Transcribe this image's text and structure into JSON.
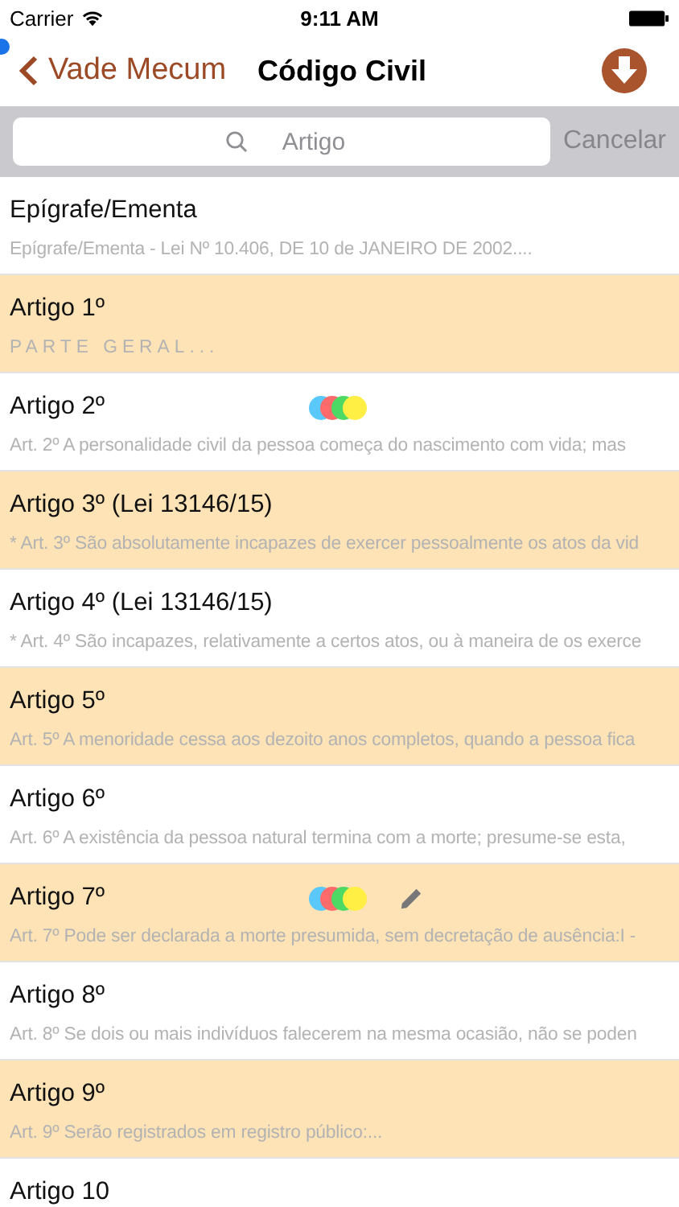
{
  "status_bar": {
    "carrier": "Carrier",
    "time": "9:11 AM"
  },
  "nav": {
    "back": "Vade Mecum",
    "title": "Código Civil"
  },
  "search": {
    "placeholder": "Artigo",
    "cancel": "Cancelar"
  },
  "rows": [
    {
      "title": "Epígrafe/Ementa",
      "summary": "Epígrafe/Ementa - Lei Nº 10.406, DE 10 de JANEIRO DE 2002....",
      "highlighted": false
    },
    {
      "title": "Artigo 1º",
      "summary": "PARTE GERAL...",
      "highlighted": true,
      "letter_spaced": true
    },
    {
      "title": "Artigo 2º",
      "summary": "Art. 2º A personalidade civil da pessoa começa do nascimento com vida; mas",
      "highlighted": false,
      "tags": [
        {
          "color": "#5ac8fa"
        },
        {
          "color": "#ff6b6b"
        },
        {
          "color": "#4cd964"
        },
        {
          "color": "#ffee44"
        }
      ]
    },
    {
      "title": "Artigo 3º (Lei 13146/15)",
      "summary": "* Art. 3º São absolutamente incapazes de exercer pessoalmente os atos da vid",
      "highlighted": true
    },
    {
      "title": "Artigo 4º (Lei 13146/15)",
      "summary": "* Art. 4º São incapazes, relativamente a certos atos, ou à maneira de os exerce",
      "highlighted": false
    },
    {
      "title": "Artigo 5º",
      "summary": "Art. 5º A menoridade cessa aos dezoito anos completos, quando a pessoa fica",
      "highlighted": true
    },
    {
      "title": "Artigo 6º",
      "summary": "Art. 6º A existência da pessoa natural termina com a morte; presume-se esta,",
      "highlighted": false
    },
    {
      "title": "Artigo 7º",
      "summary": "Art. 7º Pode ser declarada a morte presumida, sem decretação de ausência:I -",
      "highlighted": true,
      "annotated": true,
      "tags": [
        {
          "color": "#5ac8fa"
        },
        {
          "color": "#ff6b6b"
        },
        {
          "color": "#4cd964"
        },
        {
          "color": "#ffee44"
        }
      ]
    },
    {
      "title": "Artigo 8º",
      "summary": "Art. 8º Se dois ou mais indivíduos falecerem na mesma ocasião, não se poden",
      "highlighted": false
    },
    {
      "title": "Artigo 9º",
      "summary": "Art. 9º Serão registrados em registro público:...",
      "highlighted": true
    },
    {
      "title": "Artigo 10",
      "highlighted": false
    }
  ]
}
